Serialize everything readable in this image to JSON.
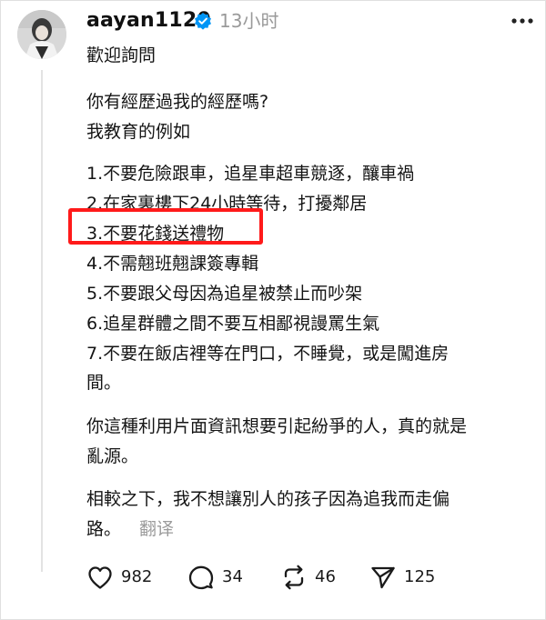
{
  "post": {
    "username": "aayan1120",
    "timestamp": "13小时",
    "lines": [
      "歡迎詢問",
      "你有經歷過我的經歷嗎?",
      "我教育的例如",
      "1.不要危險跟車，追星車超車競逐，釀車禍",
      "2.在家裏樓下24小時等待，打擾鄰居",
      "3.不要花錢送禮物",
      "4.不需翹班翹課簽專輯",
      "5.不要跟父母因為追星被禁止而吵架",
      "6.追星群體之間不要互相鄙視謾罵生氣",
      "7.不要在飯店裡等在門口，不睡覺，或是闖進房",
      "間。",
      "你這種利用片面資訊想要引起紛爭的人，真的就是",
      "亂源。",
      "相較之下，我不想讓別人的孩子因為追我而走偏",
      "路。"
    ],
    "translate_label": "翻译"
  },
  "actions": {
    "likes": "982",
    "comments": "34",
    "reposts": "46",
    "shares": "125"
  },
  "icons": {
    "verified": "verified-badge-icon",
    "more": "more-options-icon",
    "like": "heart-icon",
    "comment": "comment-bubble-icon",
    "repost": "repost-icon",
    "share": "send-icon"
  },
  "colors": {
    "verified": "#0095f6",
    "highlight": "#ff1a1a",
    "muted": "#9a9a9a"
  }
}
